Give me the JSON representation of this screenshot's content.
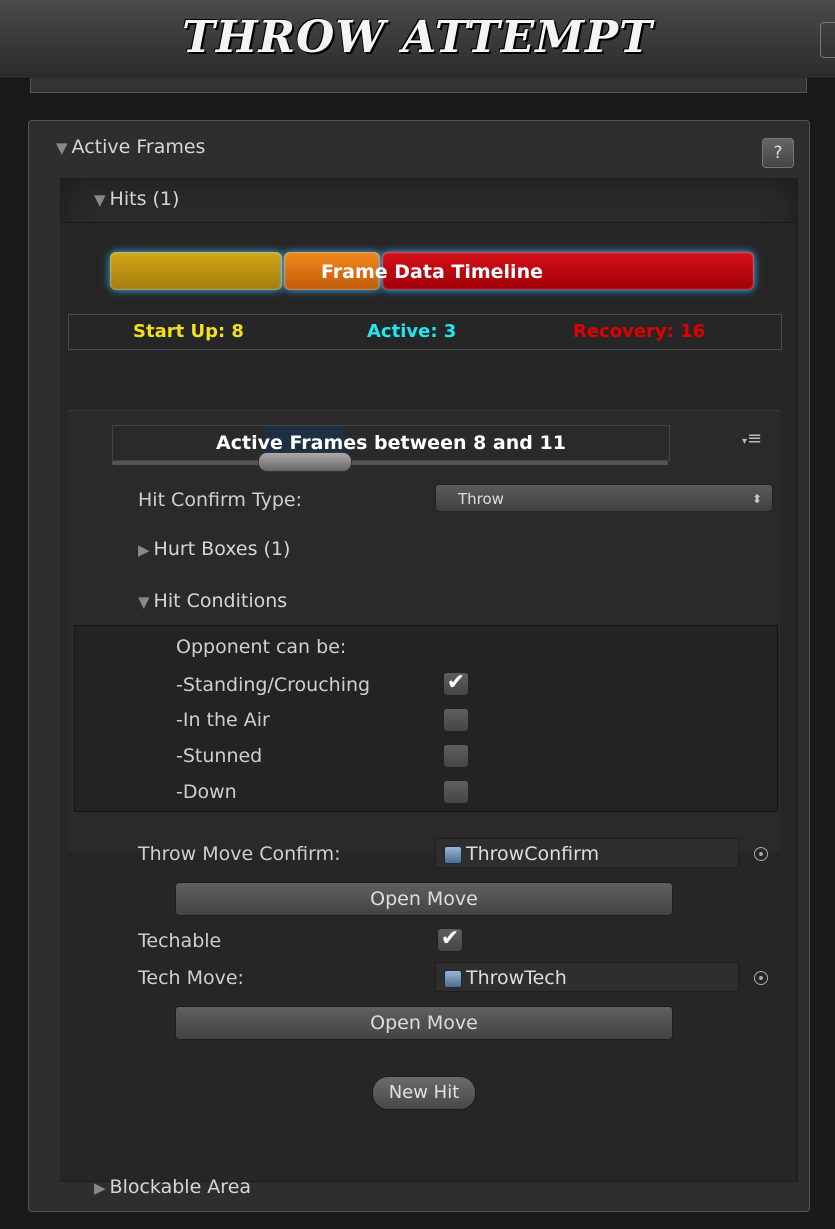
{
  "window": {
    "title": "THROW ATTEMPT"
  },
  "active_frames": {
    "label": "Active Frames",
    "help_label": "?",
    "hits_label": "Hits (1)"
  },
  "timeline": {
    "title_part1": "Frame",
    "title_part2": " Data Timeline",
    "startup_label": "Start Up: 8",
    "active_label": "Active: 3",
    "recovery_label": "Recovery: 16",
    "colors": {
      "startup": "#f0e020",
      "active": "#1ee8f0",
      "recovery": "#e00000"
    }
  },
  "hit": {
    "range_label": "Active Frames between 8 and 11",
    "menu_icon": "≡",
    "hit_confirm_type_label": "Hit Confirm Type:",
    "hit_confirm_type_value": "Throw",
    "hurt_boxes_label": "Hurt Boxes (1)",
    "hit_conditions_label": "Hit Conditions",
    "conditions": {
      "heading": "Opponent can be:",
      "items": [
        {
          "label": "-Standing/Crouching",
          "checked": "✔"
        },
        {
          "label": "-In the Air",
          "checked": ""
        },
        {
          "label": "-Stunned",
          "checked": ""
        },
        {
          "label": "-Down",
          "checked": ""
        }
      ]
    },
    "throw_move_confirm_label": "Throw Move Confirm:",
    "throw_move_confirm_value": "ThrowConfirm",
    "open_move_label": "Open Move",
    "techable_label": "Techable",
    "techable_checked": "✔",
    "tech_move_label": "Tech Move:",
    "tech_move_value": "ThrowTech"
  },
  "new_hit_label": "New Hit",
  "blockable_area_label": "Blockable Area"
}
